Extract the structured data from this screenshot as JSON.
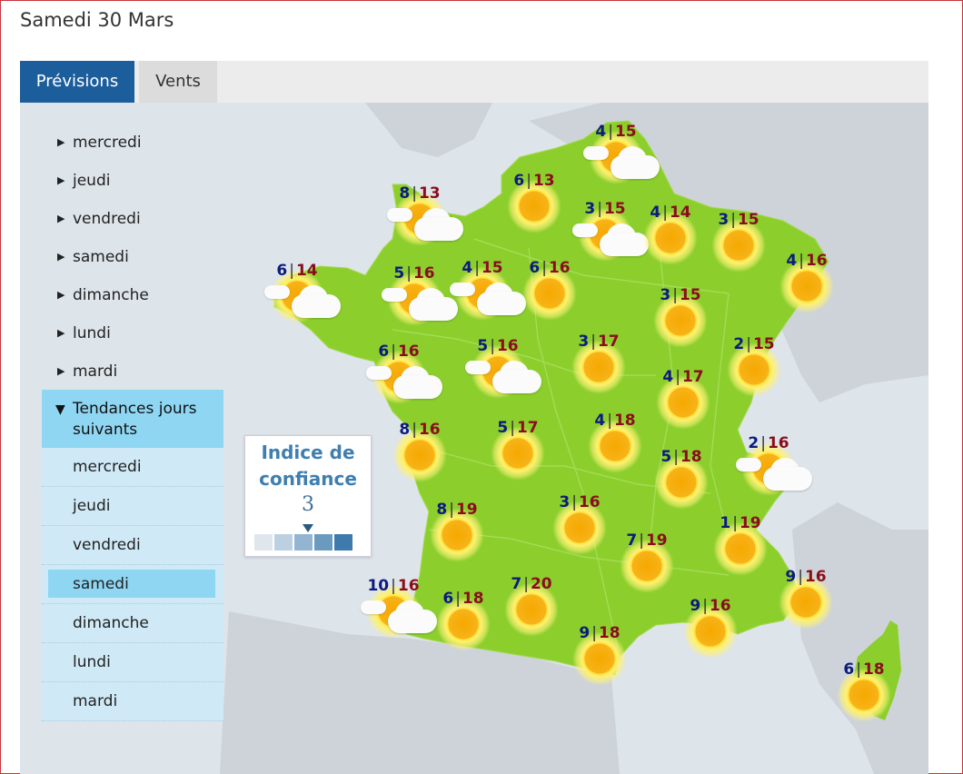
{
  "title": "Samedi 30 Mars",
  "tabs": [
    {
      "label": "Prévisions",
      "active": true
    },
    {
      "label": "Vents",
      "active": false
    }
  ],
  "days": [
    "mercredi",
    "jeudi",
    "vendredi",
    "samedi",
    "dimanche",
    "lundi",
    "mardi"
  ],
  "trend": {
    "label": "Tendances jours suivants",
    "items": [
      "mercredi",
      "jeudi",
      "vendredi",
      "samedi",
      "dimanche",
      "lundi",
      "mardi"
    ],
    "selected": "samedi"
  },
  "confidence": {
    "title_line1": "Indice de",
    "title_line2": "confiance",
    "value": "3",
    "level": 3,
    "scale_colors": [
      "#dfe6ee",
      "#bcd0e2",
      "#93b5d1",
      "#6b9abf",
      "#3e7aab"
    ]
  },
  "colors": {
    "tab_active": "#1c5d9c",
    "land": "#8ccf2d",
    "min_temp": "#0d1b7e",
    "max_temp": "#8a0d1c"
  },
  "forecasts": [
    {
      "id": "cherbourg",
      "min": "8",
      "max": "13",
      "icon": "sun-cloud-icon"
    },
    {
      "id": "lille",
      "min": "4",
      "max": "15",
      "icon": "sun-cloud-icon"
    },
    {
      "id": "amiens",
      "min": "6",
      "max": "13",
      "icon": "sun-icon"
    },
    {
      "id": "reims",
      "min": "3",
      "max": "15",
      "icon": "sun-cloud-icon"
    },
    {
      "id": "charleville",
      "min": "4",
      "max": "14",
      "icon": "sun-icon"
    },
    {
      "id": "metz",
      "min": "3",
      "max": "15",
      "icon": "sun-icon"
    },
    {
      "id": "strasbourg",
      "min": "4",
      "max": "16",
      "icon": "sun-icon"
    },
    {
      "id": "brest",
      "min": "6",
      "max": "14",
      "icon": "sun-cloud-icon"
    },
    {
      "id": "saint-brieuc",
      "min": "5",
      "max": "16",
      "icon": "sun-cloud-icon"
    },
    {
      "id": "caen",
      "min": "4",
      "max": "15",
      "icon": "sun-cloud-icon"
    },
    {
      "id": "paris",
      "min": "6",
      "max": "16",
      "icon": "sun-icon"
    },
    {
      "id": "nancy",
      "min": "3",
      "max": "15",
      "icon": "sun-icon"
    },
    {
      "id": "nantes",
      "min": "6",
      "max": "16",
      "icon": "sun-cloud-icon"
    },
    {
      "id": "tours",
      "min": "5",
      "max": "16",
      "icon": "sun-cloud-icon"
    },
    {
      "id": "orleans",
      "min": "3",
      "max": "17",
      "icon": "sun-icon"
    },
    {
      "id": "dijon",
      "min": "4",
      "max": "17",
      "icon": "sun-icon"
    },
    {
      "id": "besancon",
      "min": "2",
      "max": "15",
      "icon": "sun-icon"
    },
    {
      "id": "la-rochelle",
      "min": "8",
      "max": "16",
      "icon": "sun-icon"
    },
    {
      "id": "limoges",
      "min": "5",
      "max": "17",
      "icon": "sun-icon"
    },
    {
      "id": "vichy",
      "min": "4",
      "max": "18",
      "icon": "sun-icon"
    },
    {
      "id": "lyon",
      "min": "5",
      "max": "18",
      "icon": "sun-icon"
    },
    {
      "id": "annecy",
      "min": "2",
      "max": "16",
      "icon": "sun-cloud-icon"
    },
    {
      "id": "bordeaux",
      "min": "8",
      "max": "19",
      "icon": "sun-icon"
    },
    {
      "id": "aurillac",
      "min": "3",
      "max": "16",
      "icon": "sun-icon"
    },
    {
      "id": "montelimar",
      "min": "7",
      "max": "19",
      "icon": "sun-icon"
    },
    {
      "id": "grenoble",
      "min": "1",
      "max": "19",
      "icon": "sun-icon"
    },
    {
      "id": "biarritz",
      "min": "10",
      "max": "16",
      "icon": "sun-cloud-icon"
    },
    {
      "id": "pau",
      "min": "6",
      "max": "18",
      "icon": "sun-icon"
    },
    {
      "id": "toulouse",
      "min": "7",
      "max": "20",
      "icon": "sun-icon"
    },
    {
      "id": "marseille",
      "min": "9",
      "max": "16",
      "icon": "sun-icon"
    },
    {
      "id": "nice",
      "min": "9",
      "max": "16",
      "icon": "sun-icon"
    },
    {
      "id": "perpignan",
      "min": "9",
      "max": "18",
      "icon": "sun-icon"
    },
    {
      "id": "ajaccio",
      "min": "6",
      "max": "18",
      "icon": "sun-icon"
    }
  ]
}
